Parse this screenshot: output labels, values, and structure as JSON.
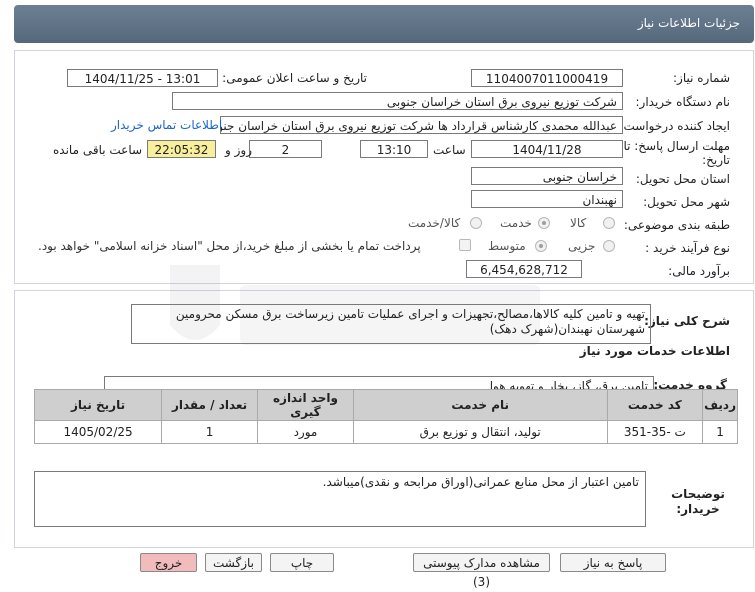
{
  "header": {
    "title": "جزئیات اطلاعات نیاز"
  },
  "form": {
    "need_number_label": "شماره نیاز:",
    "need_number": "1104007011000419",
    "announce_label": "تاریخ و ساعت اعلان عمومی:",
    "announce_value": "1404/11/25 - 13:01",
    "buyer_org_label": "نام دستگاه خریدار:",
    "buyer_org": "شرکت توزیع نیروی برق استان خراسان جنوبی",
    "creator_label": "ایجاد کننده درخواست:",
    "creator": "عبدالله محمدی کارشناس قرارداد ها شرکت توزیع نیروی برق استان خراسان جنو",
    "contact_link": "اطلاعات تماس خریدار",
    "deadline_label": "مهلت ارسال پاسخ: تا تاریخ:",
    "deadline_date": "1404/11/28",
    "hour_label": "ساعت",
    "deadline_time": "13:10",
    "days_value": "2",
    "days_label": "روز و",
    "remaining_time": "22:05:32",
    "remaining_label": "ساعت باقی مانده",
    "province_label": "استان محل تحویل:",
    "province": "خراسان جنوبی",
    "city_label": "شهر محل تحویل:",
    "city": "نهبندان",
    "category_label": "طبقه بندی موضوعی:",
    "category_options": [
      "کالا",
      "خدمت",
      "کالا/خدمت"
    ],
    "category_selected": "خدمت",
    "process_label": "نوع فرآیند خرید :",
    "process_options": [
      "جزیی",
      "متوسط"
    ],
    "process_selected": "متوسط",
    "treasury_note": "پرداخت تمام یا بخشی از مبلغ خرید،از محل \"اسناد خزانه اسلامی\" خواهد بود.",
    "budget_label": "برآورد مالی:",
    "budget": "6,454,628,712"
  },
  "description": {
    "label": "شرح کلی نیاز:",
    "text": "تهیه و تامین کلیه کالاها،مصالح،تجهیزات و اجرای عملیات تامین زیرساخت برق مسکن محرومین شهرستان نهبندان(شهرک دهک)"
  },
  "services": {
    "section_title": "اطلاعات خدمات مورد نیاز",
    "group_label": "گروه خدمت:",
    "group_value": "تامین برق، گاز، بخار و تهویه هوا",
    "columns": [
      "ردیف",
      "کد خدمت",
      "نام خدمت",
      "واحد اندازه گیری",
      "تعداد / مقدار",
      "تاریخ نیاز"
    ],
    "rows": [
      {
        "index": "1",
        "code": "ت -35-351",
        "name": "تولید، انتقال و توزیع برق",
        "unit": "مورد",
        "qty": "1",
        "date": "1405/02/25"
      }
    ]
  },
  "buyer_notes": {
    "label": "توضیحات خریدار:",
    "text": "تامین اعتبار از محل منابع عمرانی(اوراق مرابحه و نقدی)میباشد."
  },
  "buttons": {
    "reply": "پاسخ به نیاز",
    "attachments": "مشاهده مدارک پیوستی (3)",
    "print": "چاپ",
    "back": "بازگشت",
    "exit": "خروج"
  },
  "colors": {
    "header": "#5f7186",
    "remaining_bg": "#f7ef9c",
    "link": "#1a66c9",
    "exit_btn": "#f3bcbc"
  }
}
